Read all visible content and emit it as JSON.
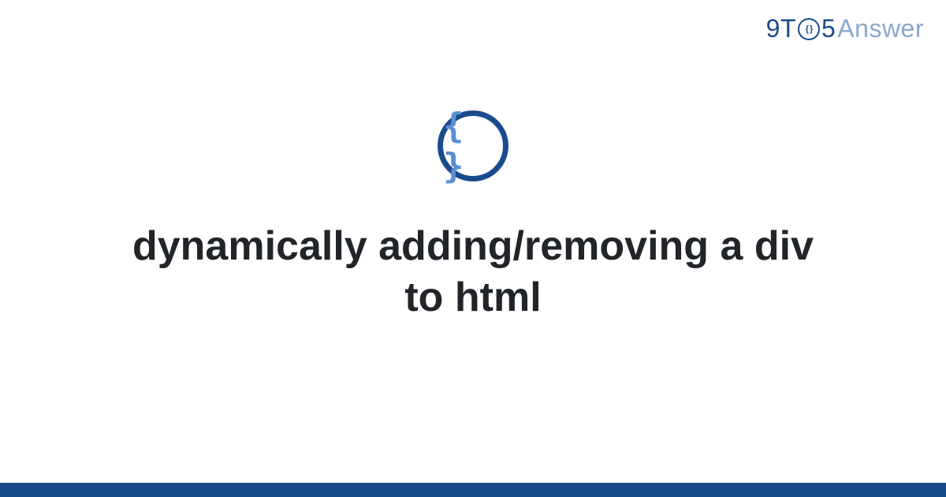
{
  "header": {
    "logo_9t": "9T",
    "logo_5": "5",
    "logo_answer": "Answer",
    "clock_inner": "{ }"
  },
  "content": {
    "icon_symbol": "{ }",
    "title": "dynamically adding/removing a div to html"
  },
  "colors": {
    "primary": "#1a4b8c",
    "secondary": "#5b8fd4",
    "muted": "#8aa8cc",
    "text": "#212529"
  }
}
